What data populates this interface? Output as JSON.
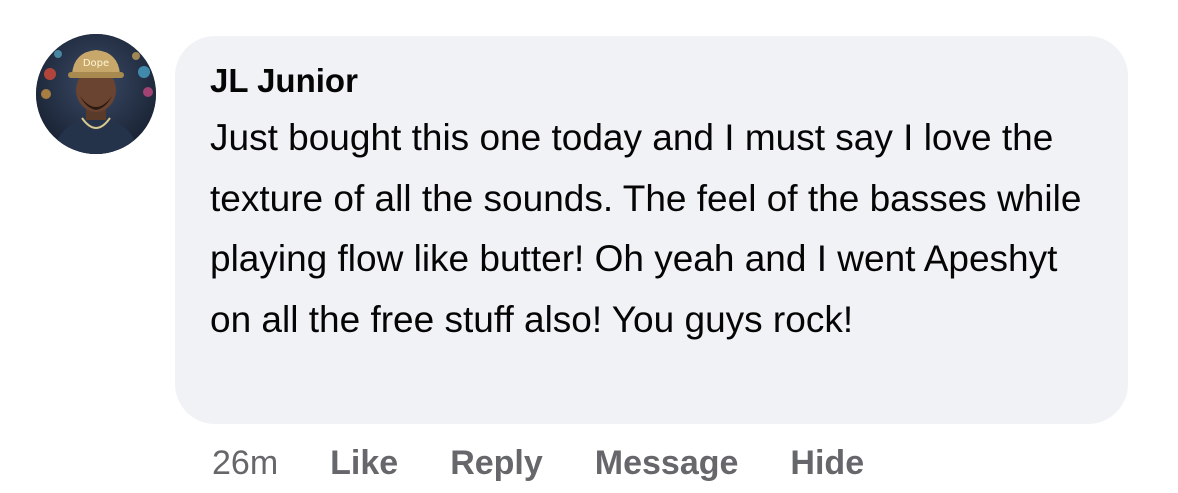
{
  "comment": {
    "author": "JL Junior",
    "text": "Just bought this one today and I must say I love the texture of all the sounds. The feel of the basses while playing flow like butter! Oh yeah and I went Apeshyt on all the free stuff also! You guys rock!",
    "timestamp": "26m",
    "actions": {
      "like": "Like",
      "reply": "Reply",
      "message": "Message",
      "hide": "Hide"
    },
    "avatar": {
      "cap_text": "Dope"
    }
  },
  "colors": {
    "bubble_bg": "#f0f2f5",
    "text": "#050505",
    "secondary": "#65676b"
  }
}
